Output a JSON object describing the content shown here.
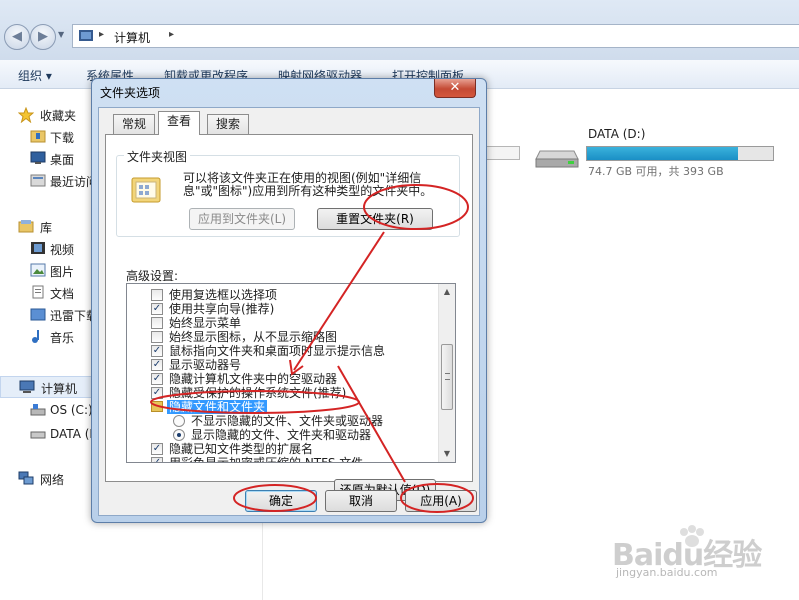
{
  "explorer": {
    "breadcrumb": "计算机",
    "toolbar": [
      "组织 ▾",
      "系统属性",
      "卸载或更改程序",
      "映射网络驱动器",
      "打开控制面板"
    ],
    "nav": {
      "favorites": "收藏夹",
      "favorites_items": [
        "下载",
        "桌面",
        "最近访问"
      ],
      "library": "库",
      "library_items": [
        "视频",
        "图片",
        "文档",
        "迅雷下载",
        "音乐"
      ],
      "computer": "计算机",
      "computer_items": [
        "OS (C:)",
        "DATA (D:)"
      ],
      "network": "网络"
    },
    "drive": {
      "label": "DATA (D:)",
      "free": "74.7 GB 可用，共 393 GB",
      "used_fraction": 0.81
    }
  },
  "dialog": {
    "title": "文件夹选项",
    "close": "✕",
    "tabs": [
      "常规",
      "查看",
      "搜索"
    ],
    "active_tab": "查看",
    "folder_view": {
      "caption": "文件夹视图",
      "desc": "可以将该文件夹正在使用的视图(例如\"详细信息\"或\"图标\")应用到所有这种类型的文件夹中。",
      "apply_btn": "应用到文件夹(L)",
      "reset_btn": "重置文件夹(R)"
    },
    "advanced_label": "高级设置:",
    "advanced": [
      {
        "type": "checkbox",
        "checked": false,
        "text": "使用复选框以选择项"
      },
      {
        "type": "checkbox",
        "checked": true,
        "text": "使用共享向导(推荐)"
      },
      {
        "type": "checkbox",
        "checked": false,
        "text": "始终显示菜单"
      },
      {
        "type": "checkbox",
        "checked": false,
        "text": "始终显示图标，从不显示缩略图"
      },
      {
        "type": "checkbox",
        "checked": true,
        "text": "鼠标指向文件夹和桌面项时显示提示信息"
      },
      {
        "type": "checkbox",
        "checked": true,
        "text": "显示驱动器号"
      },
      {
        "type": "checkbox",
        "checked": true,
        "text": "隐藏计算机文件夹中的空驱动器"
      },
      {
        "type": "checkbox",
        "checked": true,
        "text": "隐藏受保护的操作系统文件(推荐)"
      },
      {
        "type": "folder",
        "text": "隐藏文件和文件夹"
      },
      {
        "type": "radio",
        "checked": false,
        "text": "不显示隐藏的文件、文件夹或驱动器"
      },
      {
        "type": "radio",
        "checked": true,
        "text": "显示隐藏的文件、文件夹和驱动器"
      },
      {
        "type": "checkbox",
        "checked": true,
        "text": "隐藏已知文件类型的扩展名"
      },
      {
        "type": "checkbox",
        "checked": true,
        "text": "用彩色显示加密或压缩的 NTFS 文件"
      }
    ],
    "restore_btn": "还原为默认值(D)",
    "ok_btn": "确定",
    "cancel_btn": "取消",
    "apply_btn": "应用(A)"
  },
  "watermark": {
    "text": "Baidu经验",
    "sub": "jingyan.baidu.com"
  },
  "colors": {
    "annotation": "#d42424",
    "selection": "#3399ff",
    "drive_fill": "#1a8fc5"
  }
}
